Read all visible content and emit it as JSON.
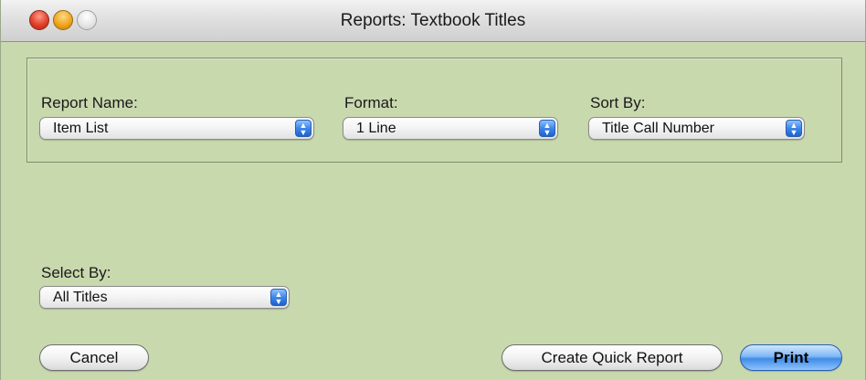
{
  "window": {
    "title": "Reports: Textbook Titles"
  },
  "report_name": {
    "label": "Report Name:",
    "selected": "Item List"
  },
  "format": {
    "label": "Format:",
    "selected": "1 Line"
  },
  "sort_by": {
    "label": "Sort By:",
    "selected": "Title Call Number"
  },
  "select_by": {
    "label": "Select By:",
    "selected": "All Titles"
  },
  "buttons": {
    "cancel": "Cancel",
    "create_quick_report": "Create Quick Report",
    "print": "Print"
  },
  "colors": {
    "window_background": "#c9d9ae",
    "default_button": "#3f8be6"
  }
}
